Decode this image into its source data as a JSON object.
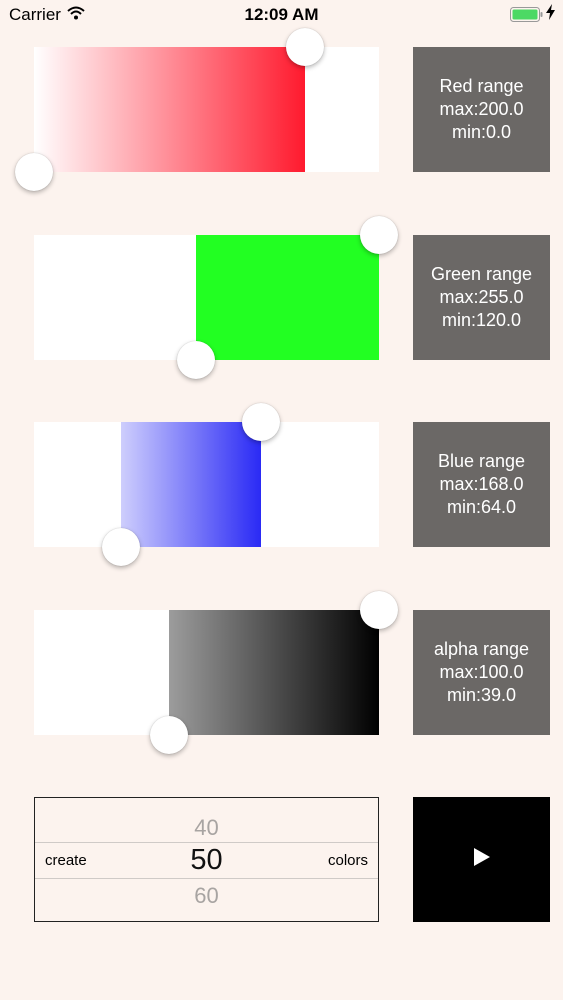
{
  "status_bar": {
    "carrier": "Carrier",
    "time": "12:09 AM",
    "icons": [
      "wifi-icon",
      "battery-icon",
      "charging-bolt-icon"
    ],
    "battery_color": "#4cd964"
  },
  "ranges": [
    {
      "id": "red",
      "title": "Red range",
      "max_text": "max:200.0",
      "min_text": "min:0.0",
      "max": 200,
      "min": 0,
      "scale_max": 255,
      "color": "#ff1a2e"
    },
    {
      "id": "green",
      "title": "Green range",
      "max_text": "max:255.0",
      "min_text": "min:120.0",
      "max": 255,
      "min": 120,
      "scale_max": 255,
      "color": "#22ff22"
    },
    {
      "id": "blue",
      "title": "Blue range",
      "max_text": "max:168.0",
      "min_text": "min:64.0",
      "max": 168,
      "min": 64,
      "scale_max": 255,
      "color": "#2a2af5"
    },
    {
      "id": "alpha",
      "title": "alpha range",
      "max_text": "max:100.0",
      "min_text": "min:39.0",
      "max": 100,
      "min": 39,
      "scale_max": 100,
      "color": "#000000"
    }
  ],
  "picker": {
    "left_label": "create",
    "right_label": "colors",
    "prev_value": "40",
    "selected_value": "50",
    "next_value": "60"
  },
  "play_button": {
    "icon": "play-icon"
  },
  "colors": {
    "background": "#fcf3ee",
    "info_panel": "#6b6866",
    "play_button": "#000000"
  }
}
